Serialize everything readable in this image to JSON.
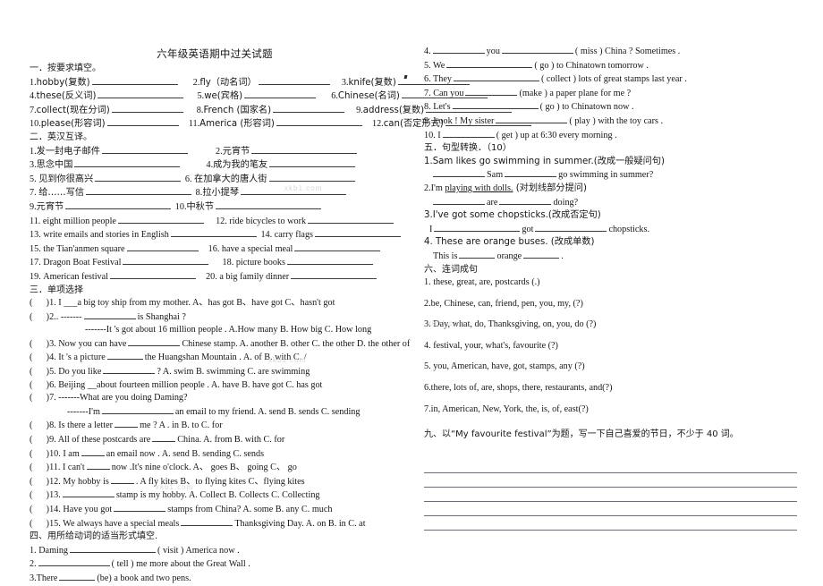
{
  "title": "六年级英语期中过关试题",
  "section1": {
    "heading": "一．按要求填空。",
    "items": [
      {
        "n": "1.",
        "text": "hobby(复数)",
        "blank": "b-xl"
      },
      {
        "n": "2.",
        "text": "fly（动名词）",
        "blank": "b-l"
      },
      {
        "n": "3.",
        "text": "knife(复数)",
        "blank": "b-l"
      },
      {
        "n": "4.",
        "text": "these(反义词)",
        "blank": "b-xl"
      },
      {
        "n": "5.",
        "text": "we(宾格)",
        "blank": "b-l"
      },
      {
        "n": "6.",
        "text": "Chinese(名词)",
        "blank": "b-xl"
      },
      {
        "n": "7.",
        "text": "collect(现在分词)",
        "blank": "b-l"
      },
      {
        "n": "8.",
        "text": "French (国家名)",
        "blank": "b-l"
      },
      {
        "n": "9.",
        "text": "address(复数)",
        "blank": "b-xl"
      },
      {
        "n": "10.",
        "text": "please(形容词)",
        "blank": "b-l"
      },
      {
        "n": "11.",
        "text": "America (形容词)",
        "blank": "b-xl"
      },
      {
        "n": "12.",
        "text": "can(否定形式)",
        "blank": "b-xl"
      }
    ]
  },
  "section2": {
    "heading": "二．英汉互译。",
    "items": [
      {
        "n": "1.",
        "text": "发一封电子邮件"
      },
      {
        "n": "2.",
        "text": "元宵节"
      },
      {
        "n": "3.",
        "text": "思念中国"
      },
      {
        "n": "4.",
        "text": "成为我的笔友"
      },
      {
        "n": "5.",
        "text": "见到你很高兴"
      },
      {
        "n": "6.",
        "text": "在加拿大的唐人街"
      },
      {
        "n": "7.",
        "text": "给……写信"
      },
      {
        "n": "8.",
        "text": "拉小提琴"
      },
      {
        "n": "9.",
        "text": "元宵节"
      },
      {
        "n": "10.",
        "text": "中秋节"
      },
      {
        "n": "11.",
        "text": "eight million people"
      },
      {
        "n": "12.",
        "text": "ride bicycles to work"
      },
      {
        "n": "13.",
        "text": "write emails and stories in English"
      },
      {
        "n": "14.",
        "text": "carry flags"
      },
      {
        "n": "15.",
        "text": "the Tian'anmen square"
      },
      {
        "n": "16.",
        "text": "have a special meal"
      },
      {
        "n": "17.",
        "text": "Dragon Boat Festival"
      },
      {
        "n": "18.",
        "text": "picture books"
      },
      {
        "n": "19.",
        "text": "American festival"
      },
      {
        "n": "20.",
        "text": "a big family dinner"
      }
    ]
  },
  "section3": {
    "heading": "三．单项选择",
    "q1": "1. I ___a  big  toy  ship  from  my  mother.   A、has  got      B、have got   C、hasn't   got",
    "q2_a": "2.. -------",
    "q2_b": "is  Shanghai ?",
    "q2_cont": "-------It 's got about 16 million people . A.How many  B. How big  C. How long",
    "q3_a": "3. Now you can have",
    "q3_b": "Chinese stamp. A. another  B. other C. the other D. the other of",
    "q4_a": "4. It 's a picture",
    "q4_b": "the Huangshan Mountain . A. of          B. with       C.     /",
    "q5_a": "5. Do you like",
    "q5_b": "? A. swim B. swimming C. are swimming",
    "q6": "6. Beijing __about fourteen million people . A. have         B. have got      C. has got",
    "q7": "7. -------What are you doing Daming?",
    "q7_cont_a": "-------I'm",
    "q7_cont_b": "an email to my friend.  A. send      B. sends       C. sending",
    "q8_a": "8. Is there  a  letter",
    "q8_b": "me ?  A . in              B.  to         C. for",
    "q9_a": "9. All  of  these  postcards  are",
    "q9_b": "China.   A. from             B. with        C.    for",
    "q10_a": "10. I  am",
    "q10_b": "an email now .  A. send         B. sending  C. sends",
    "q11_a": "11. I  can't",
    "q11_b": "now .It's  nine  o'clock.   A、    goes    B、  going     C、  go",
    "q12_a": "12. My  hobby  is",
    "q12_b": ".    A  fly kites  B、to flying kites    C、flying kites",
    "q13_a": "13.",
    "q13_b": "stamp is my hobby. A. Collect      B. Collects      C. Collecting",
    "q14_a": "14. Have you got",
    "q14_b": "stamps from China? A. some      B. any       C. much",
    "q15_a": "15. We always have a special meals",
    "q15_b": "Thanksgiving Day. A. on              B. in         C. at"
  },
  "section4": {
    "heading": "四、用所给动词的适当形式填空.",
    "q1_a": "1. Daming",
    "q1_b": "( visit ) America now .",
    "q2_a": "2.",
    "q2_b": "( tell ) me more about the Great Wall .",
    "q3_a": "3.There",
    "q3_b": "(be) a book and two pens.",
    "q4_a": "4.",
    "q4_b": "you",
    "q4_c": "( miss ) China ? Sometimes .",
    "q5_a": "5. We",
    "q5_b": "( go ) to Chinatown tomorrow .",
    "q6_a": "6. They",
    "q6_b": "( collect ) lots of great stamps last year .",
    "q7_a": "7. Can you",
    "q7_b": "(make ) a paper plane for me ?",
    "q8_a": "8. Let's",
    "q8_b": "( go ) to Chinatown now .",
    "q9_a": "9. Look ! My sister",
    "q9_b": "( play ) with the toy cars .",
    "q10_a": "10. I",
    "q10_b": "( get ) up at 6:30 every morning ."
  },
  "section5": {
    "heading": "五．句型转换．（10）",
    "q1": "1.Sam likes go swimming in summer.(改成一般疑问句)",
    "q1_a": "Sam",
    "q1_b": "go swimming in summer?",
    "q2_pre": "2.I'm ",
    "q2_under": "playing with dolls.",
    "q2_post": " (对划线部分提问)",
    "q2_a": "are",
    "q2_b": "doing?",
    "q3": "3.I've got some chopsticks.(改成否定句)",
    "q3_a": "I",
    "q3_b": "got",
    "q3_c": "chopsticks.",
    "q4": "4. These are orange buses. (改成单数)",
    "q4_a": "This  is",
    "q4_b": "orange",
    "q4_c": "."
  },
  "section6": {
    "heading": "六、连词成句",
    "items": [
      "1. these,  great,  are,  postcards  (.)",
      "2.be,  Chinese,  can,  friend,  pen,  you, my,     (?)",
      "3. Day,  what,  do,  Thanksgiving, on, you, do (?)",
      "4. festival,  your,  what's,  favourite (?)",
      "5. you, American,  have,  got,  stamps, any (?)",
      "6.there,  lots of,  are,  shops,  there,  restaurants,  and(?)",
      "7.in,  American,  New,  York,  the,  is,  of,  east(?)"
    ]
  },
  "section9": {
    "heading": "九、以“My favourite festival”为题，写一下自己喜爱的节日，不少于 40 词。",
    "line_count": 5
  },
  "watermarks": [
    "xkb1.com",
    "xkb1.com",
    "xkb1.com",
    "xkb1.com"
  ]
}
